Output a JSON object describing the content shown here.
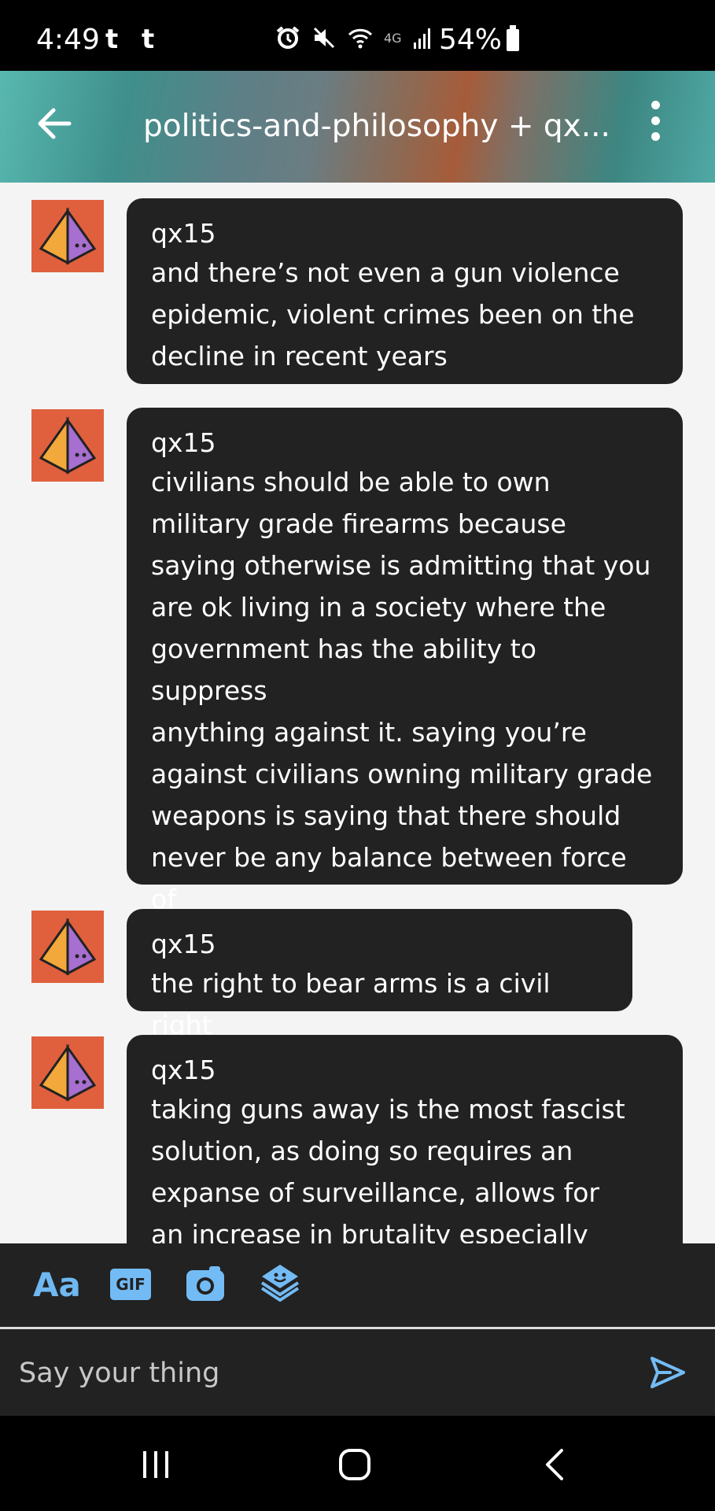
{
  "status_bar": {
    "time": "4:49",
    "notif_glyph_1": "t",
    "notif_glyph_2": "t",
    "network_label": "4G",
    "battery": "54%"
  },
  "header": {
    "title": "politics-and-philosophy + qx..."
  },
  "messages": [
    {
      "author": "qx15",
      "text": "and there’s not even a gun violence\nepidemic, violent crimes been on the\ndecline in recent years"
    },
    {
      "author": "qx15",
      "text": "civilians should be able to own\nmilitary grade firearms because\nsaying otherwise is admitting that you\nare ok living in a society where the\ngovernment has the ability to suppress\nanything against it. saying you’re\nagainst civilians owning military grade\nweapons is saying that there should\nnever be any balance between force of\nstate against civilians"
    },
    {
      "author": "qx15",
      "text": "the right to bear arms is a civil right"
    },
    {
      "author": "qx15",
      "text": "taking guns away is the most fascist\nsolution, as doing so requires an\nexpanse of surveillance, allows for\nan increase in brutality especially"
    }
  ],
  "toolbar": {
    "text_style_label": "Aa",
    "gif_label": "GIF",
    "icons": [
      "text-format-icon",
      "gif-icon",
      "camera-icon",
      "sticker-icon"
    ]
  },
  "composer": {
    "placeholder": "Say your thing"
  },
  "colors": {
    "bubble": "#222222",
    "accent": "#6fb8f2",
    "avatar_bg": "#e0603e",
    "page_bg": "#f4f4f4"
  }
}
